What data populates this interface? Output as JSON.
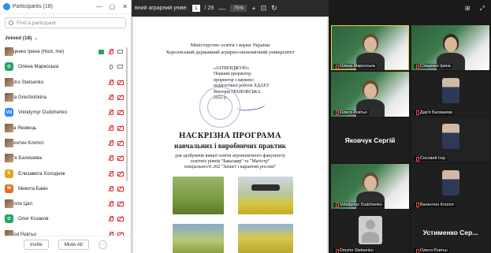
{
  "participants_panel": {
    "title": "Participants (18)",
    "search_placeholder": "Find a participant",
    "joined_label": "Joined (18)",
    "participants": [
      {
        "name": "Стеценко Ірина (Host, me)",
        "initials": "",
        "avatar_color": "photo"
      },
      {
        "name": "Олена Маркоська",
        "initials": "О",
        "avatar_color": "#23a566"
      },
      {
        "name": "Dmytro Stetsenko",
        "initials": "",
        "avatar_color": "photo"
      },
      {
        "name": "Toma Grechishkina",
        "initials": "",
        "avatar_color": "photo"
      },
      {
        "name": "Volodymyr Dudchenko",
        "initials": "VD",
        "avatar_color": "#2d8cff"
      },
      {
        "name": "Анна Яковець",
        "initials": "",
        "avatar_color": "photo"
      },
      {
        "name": "Валентин Клопот",
        "initials": "",
        "avatar_color": "photo"
      },
      {
        "name": "Дар'я Балишева",
        "initials": "",
        "avatar_color": "photo"
      },
      {
        "name": "Єлизавета Холодняк",
        "initials": "Є",
        "avatar_color": "#e8a21a"
      },
      {
        "name": "Микита Бакін",
        "initials": "М",
        "avatar_color": "#e0702c"
      },
      {
        "name": "Микола Цап",
        "initials": "",
        "avatar_color": "photo"
      },
      {
        "name": "Олег Козаков",
        "initials": "О",
        "avatar_color": "#23a566"
      },
      {
        "name": "Олеся Рєвтьо",
        "initials": "",
        "avatar_color": "photo"
      },
      {
        "name": "Сосовей Ігор",
        "initials": "С",
        "avatar_color": "#e0463a"
      }
    ],
    "invite_label": "Invite",
    "mute_all_label": "Mute All",
    "more_label": "···"
  },
  "viewer": {
    "doc_title": "вний аграрний уніве...",
    "page_current": "1",
    "page_total": "/ 29",
    "zoom": "75%",
    "zoom_out": "—",
    "zoom_in": "+"
  },
  "document": {
    "ministry": "Міністерство освіти і науки України",
    "university": "Херсонський державний аграрно-економічний університет",
    "approve_lines": [
      "«ЗАТВЕРДЖУЮ»",
      "Перший проректор,",
      "проректор з науково-",
      "педагогічної роботи ХДАЕУ",
      "Вікторія ГРАНОВСЬКА",
      "2022 р."
    ],
    "title": "НАСКРІЗНА ПРОГРАМА",
    "subtitle": "навчальних і виробничих практик",
    "desc_lines": [
      "для здобувачів вищої освіти агрономічного факультету",
      "освітніх рівнів \"Бакалавр\" та \"Магістр\"",
      "спеціальності 202 \"Захист і карантин рослин\""
    ]
  },
  "gallery": {
    "tiles": [
      {
        "label": "Олена Маркоська",
        "kind": "photo",
        "active": true
      },
      {
        "label": "Стеценко Ірина",
        "kind": "photo",
        "active": false
      },
      {
        "label": "Олеся Рєвтьо",
        "kind": "photo",
        "active": false
      },
      {
        "label": "Дар'я Балишева",
        "kind": "small",
        "active": false
      },
      {
        "label": "",
        "big_name": "Яковчук Сергій",
        "kind": "name",
        "active": false
      },
      {
        "label": "Сосовей Ігор",
        "kind": "dark",
        "active": false
      },
      {
        "label": "Volodymyr Dudchenko",
        "kind": "photo",
        "active": false
      },
      {
        "label": "Валентин Клопот",
        "kind": "small",
        "active": false
      },
      {
        "label": "Dmytro Stetsenko",
        "kind": "gray",
        "active": false
      },
      {
        "label": "Олеся Рєвтьо",
        "big_name": "Устименко Сер...",
        "kind": "name",
        "active": false
      }
    ]
  }
}
